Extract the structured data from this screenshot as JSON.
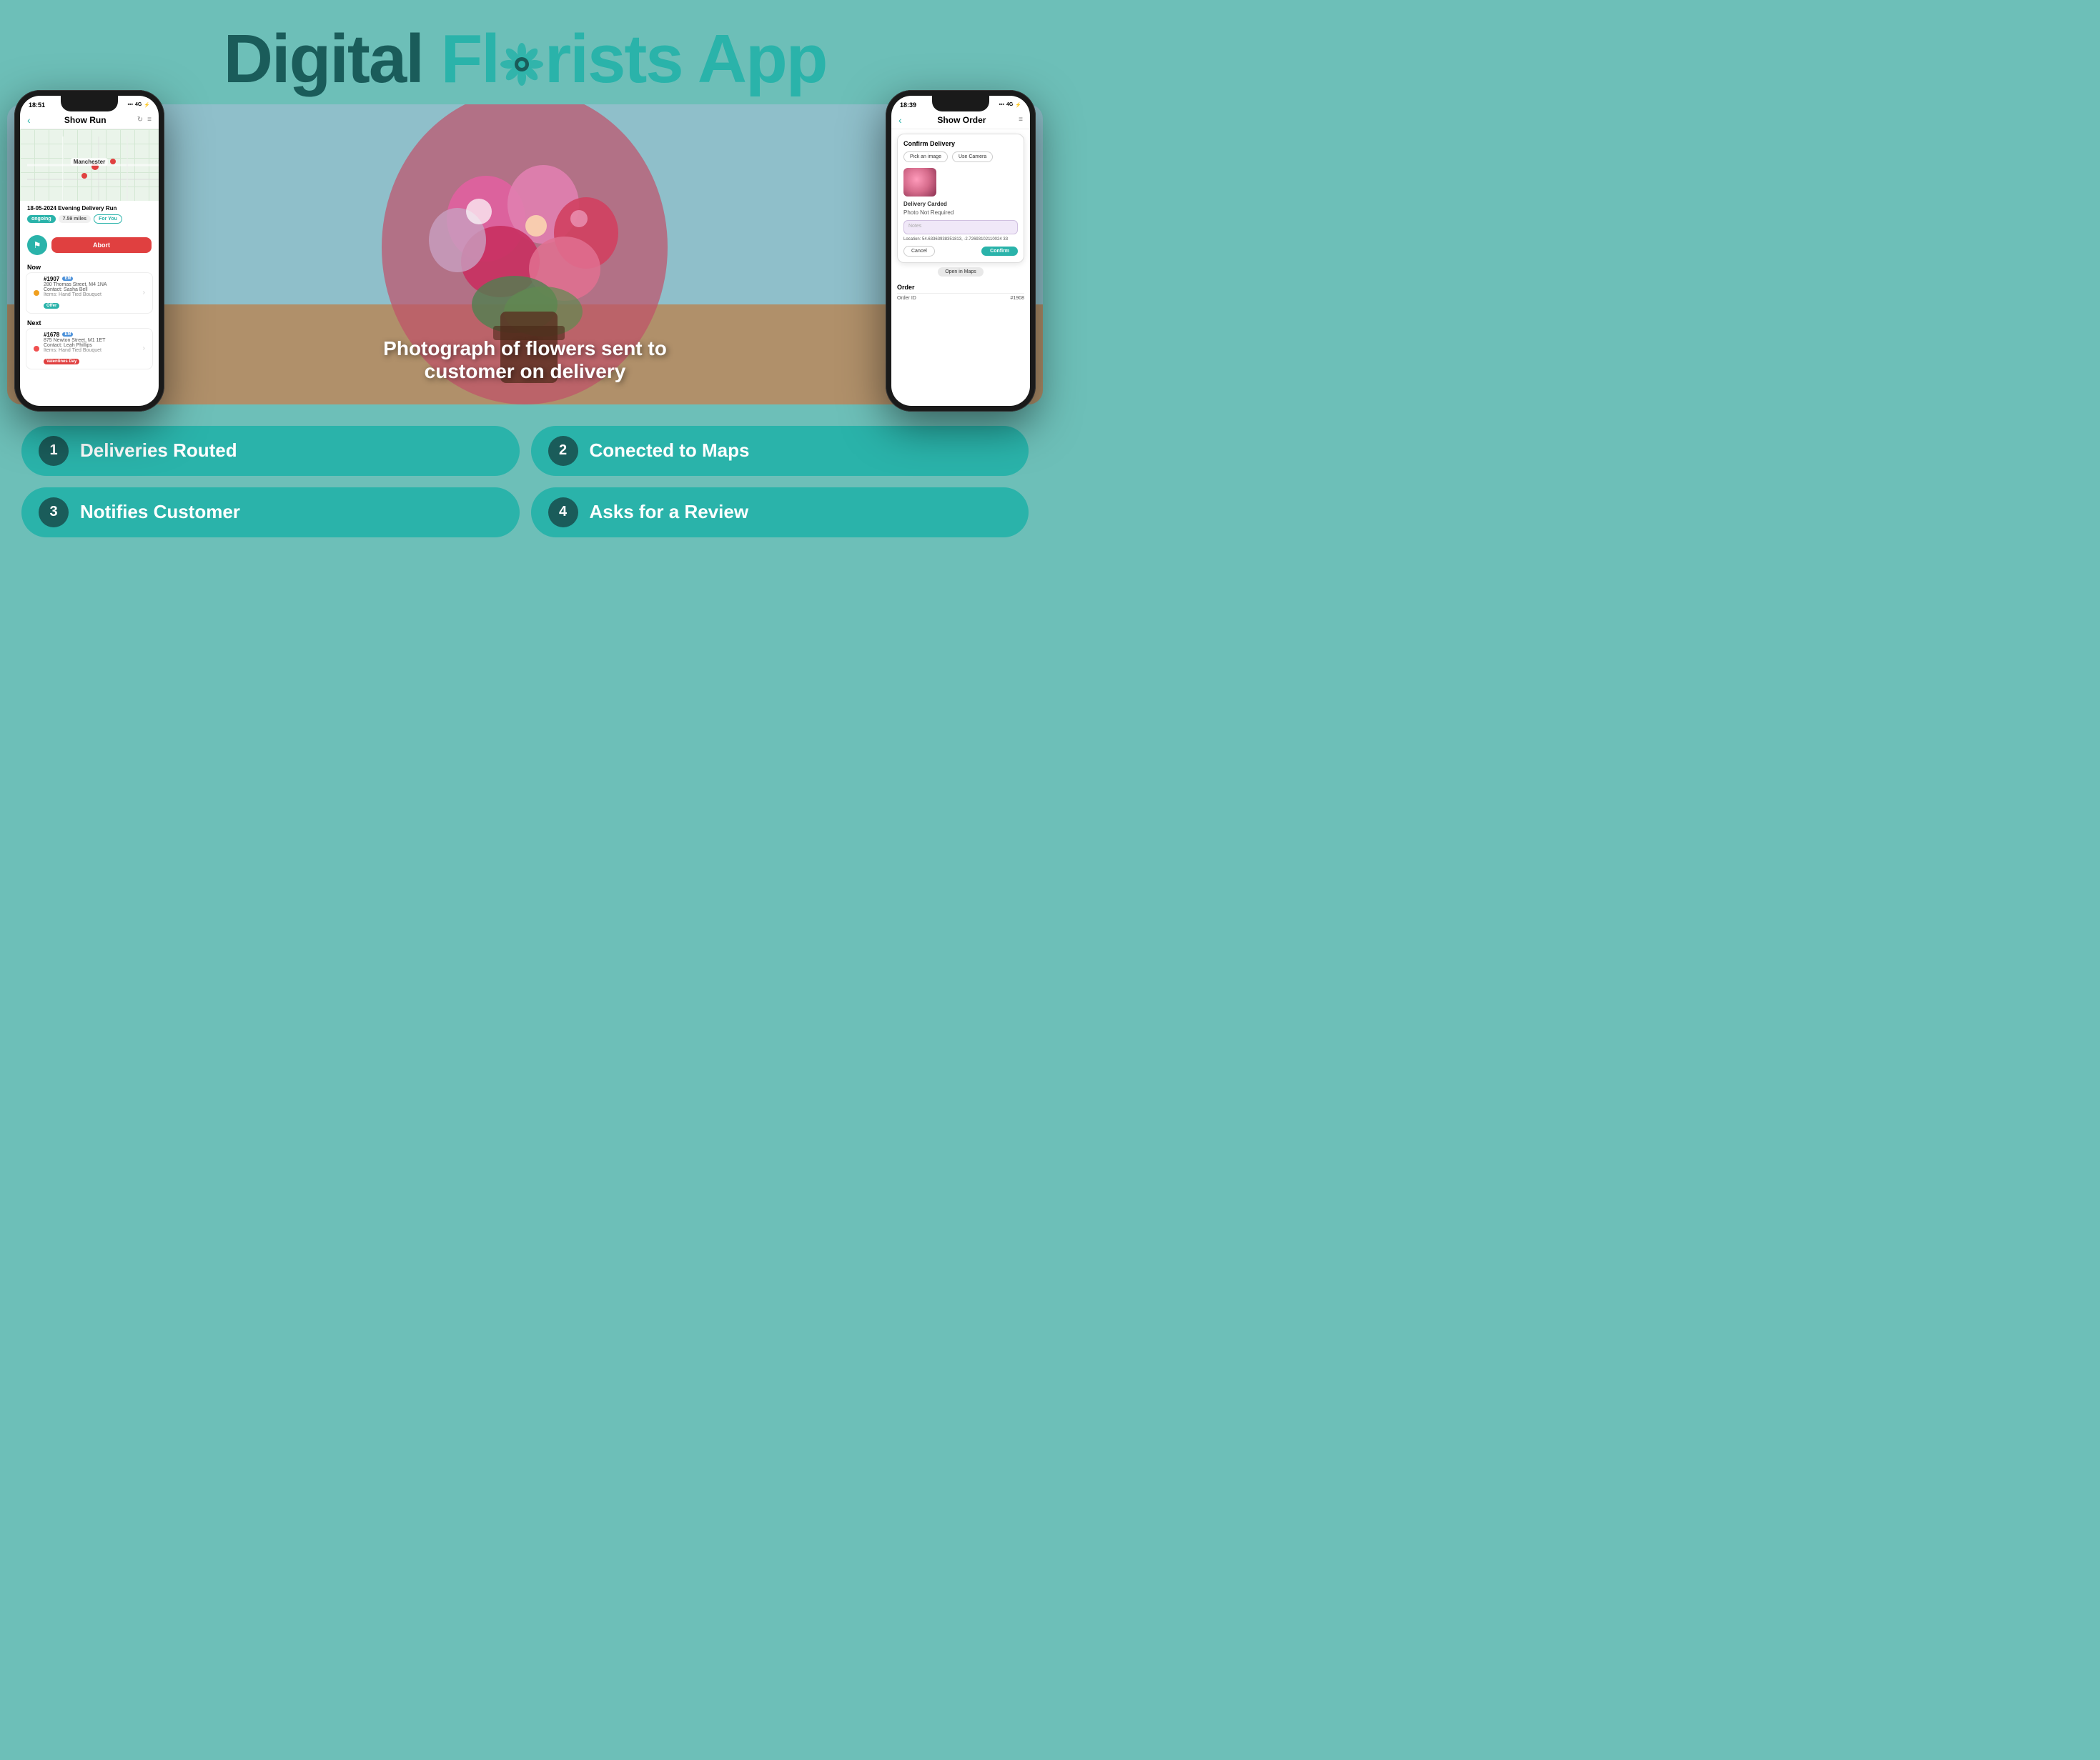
{
  "header": {
    "title_part1": "Digital ",
    "title_part2": "Fl",
    "title_part3": "rists App"
  },
  "left_phone": {
    "status_bar": {
      "time": "18:51",
      "signal": "4G",
      "battery": "⚡"
    },
    "nav": {
      "back": "‹",
      "title": "Show Run",
      "menu": "≡"
    },
    "map": {
      "label": "Manchester"
    },
    "delivery": {
      "title": "18-05-2024 Evening Delivery Run",
      "badge_ongoing": "ongoing",
      "badge_miles": "7.59 miles",
      "badge_foryou": "For You"
    },
    "abort_button": "Abort",
    "now_label": "Now",
    "orders": [
      {
        "number": "#1907",
        "badge": "EM",
        "address": "280 Thomas Street, M4 1NA",
        "contact_label": "Contact:",
        "contact": "Sasha Bell",
        "items_label": "Items:",
        "item": "Hand Tied Bouquet",
        "tag": "Offer",
        "tag_type": "offer"
      }
    ],
    "next_label": "Next",
    "next_orders": [
      {
        "number": "#1678",
        "badge": "EM",
        "address": "875 Newton Street, M1 1ET",
        "contact_label": "Contact:",
        "contact": "Leah Phillips",
        "items_label": "Items:",
        "item": "Hand Tied Bouquet",
        "tag": "Valentines Day",
        "tag_type": "val"
      }
    ]
  },
  "center": {
    "caption_line1": "Photograph of flowers sent to",
    "caption_line2": "customer on delivery"
  },
  "right_phone": {
    "status_bar": {
      "time": "18:39",
      "signal": "4G",
      "battery": "⚡"
    },
    "nav": {
      "back": "‹",
      "title": "Show Order",
      "menu": "≡"
    },
    "confirm_delivery": {
      "title": "Confirm Delivery",
      "pick_image": "Pick an image",
      "use_camera": "Use Camera",
      "delivery_status": "Delivery Carded",
      "photo_required": "Photo Not Required",
      "notes_placeholder": "Notes",
      "location": "Location: 54.63363938351813, -2.72693102110024 33",
      "cancel": "Cancel",
      "confirm": "Confirm"
    },
    "open_maps": "Open in Maps",
    "order_section": {
      "title": "Order",
      "order_id_label": "Order ID",
      "order_id_value": "#1908"
    }
  },
  "features": [
    {
      "number": "1",
      "label": "Deliveries Routed"
    },
    {
      "number": "2",
      "label": "Conected to Maps"
    },
    {
      "number": "3",
      "label": "Notifies Customer"
    },
    {
      "number": "4",
      "label": "Asks for a Review"
    }
  ]
}
